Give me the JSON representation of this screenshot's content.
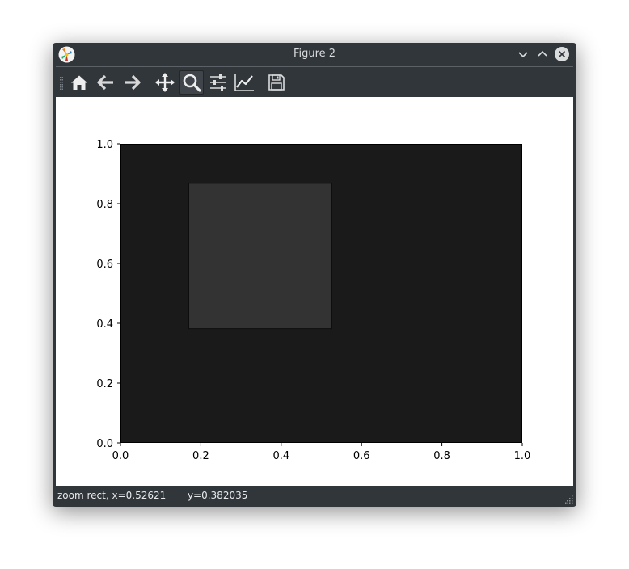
{
  "window": {
    "title": "Figure 2"
  },
  "toolbar": {
    "items": [
      {
        "name": "home-icon",
        "tooltip": "Reset original view"
      },
      {
        "name": "back-icon",
        "tooltip": "Back to previous view"
      },
      {
        "name": "forward-icon",
        "tooltip": "Forward to next view"
      },
      {
        "name": "pan-icon",
        "tooltip": "Pan axes"
      },
      {
        "name": "zoom-icon",
        "tooltip": "Zoom to rectangle",
        "active": true
      },
      {
        "name": "subplots-icon",
        "tooltip": "Configure subplots"
      },
      {
        "name": "axes-edit-icon",
        "tooltip": "Edit axis, curve and image parameters"
      },
      {
        "name": "save-icon",
        "tooltip": "Save the figure"
      }
    ]
  },
  "status": {
    "message": "zoom rect, x=0.52621       y=0.382035"
  },
  "colors": {
    "window_bg": "#31363b",
    "axes_face": "#1a1a1a",
    "zoom_rect": "#333333",
    "canvas_bg": "#ffffff"
  },
  "chart_data": {
    "type": "scatter",
    "title": "",
    "xlabel": "",
    "ylabel": "",
    "xlim": [
      0.0,
      1.0
    ],
    "ylim": [
      0.0,
      1.0
    ],
    "xticks": [
      0.0,
      0.2,
      0.4,
      0.6,
      0.8,
      1.0
    ],
    "yticks": [
      0.0,
      0.2,
      0.4,
      0.6,
      0.8,
      1.0
    ],
    "xtick_labels": [
      "0.0",
      "0.2",
      "0.4",
      "0.6",
      "0.8",
      "1.0"
    ],
    "ytick_labels": [
      "0.0",
      "0.2",
      "0.4",
      "0.6",
      "0.8",
      "1.0"
    ],
    "grid": false,
    "series": [],
    "zoom_rectangle": {
      "x0": 0.17,
      "x1": 0.526,
      "y0": 0.382,
      "y1": 0.868
    }
  }
}
